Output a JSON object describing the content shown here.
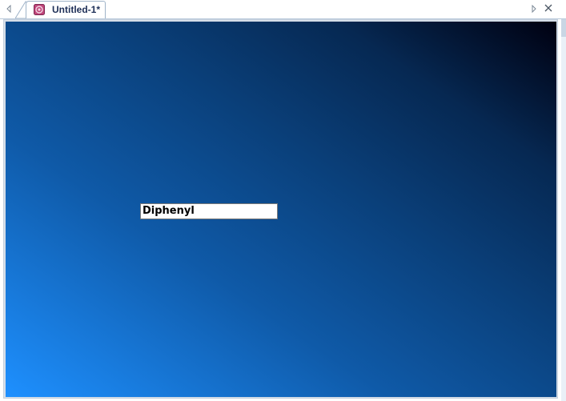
{
  "tabbar": {
    "tabs": [
      {
        "title": "Untitled-1*",
        "icon": "document-app-icon",
        "active": true
      }
    ],
    "nav_left_icon": "scroll-left-icon",
    "nav_right_icon": "scroll-right-icon",
    "close_icon": "close-icon"
  },
  "canvas": {
    "gradient": [
      "#1e90ff",
      "#0f5aa8",
      "#0a3f79",
      "#062852",
      "#000010"
    ],
    "label": {
      "text": "Diphenyl"
    }
  },
  "colors": {
    "tab_text": "#1e2f57",
    "tab_border": "#9fb3c8",
    "frame": "#d6dee8"
  }
}
